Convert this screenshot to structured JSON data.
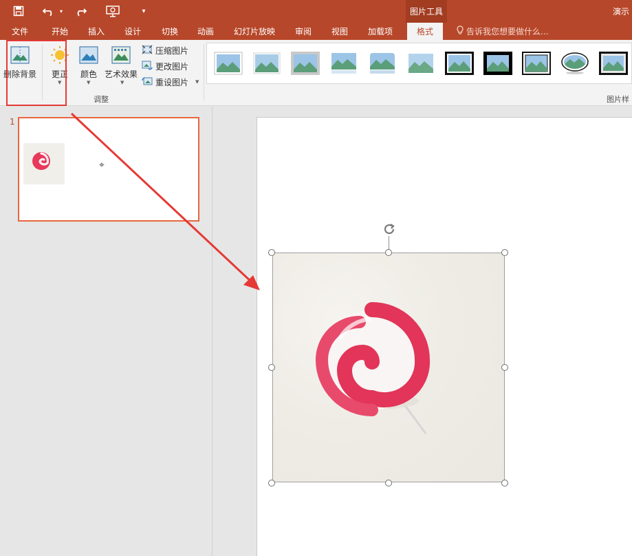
{
  "titlebar": {
    "contextual_tab_label": "图片工具",
    "window_title": "演示",
    "bg_color": "#b7472a",
    "icons": [
      "save-icon",
      "undo-icon",
      "dropdown-arrow-icon",
      "redo-icon",
      "present-from-start-icon",
      "customize-qat-icon"
    ]
  },
  "tabs": {
    "items": [
      "文件",
      "开始",
      "插入",
      "设计",
      "切换",
      "动画",
      "幻灯片放映",
      "审阅",
      "视图",
      "加载项"
    ],
    "active": "格式",
    "tellme": "告诉我您想要做什么..."
  },
  "ribbon": {
    "remove_bg": "删除背景",
    "corrections": "更正",
    "color": "颜色",
    "artistic": "艺术效果",
    "compress": "压缩图片",
    "change": "更改图片",
    "reset": "重设图片",
    "adjust_group": "调整",
    "styles_group": "图片样",
    "highlight_color": "#e53935"
  },
  "thumbnails": {
    "slide_number": "1",
    "cursor_glyph": "⌖"
  },
  "accent": {
    "candy_pink": "#e8385c",
    "candy_white": "#f7f3f3",
    "selection_border": "#e8663f"
  }
}
